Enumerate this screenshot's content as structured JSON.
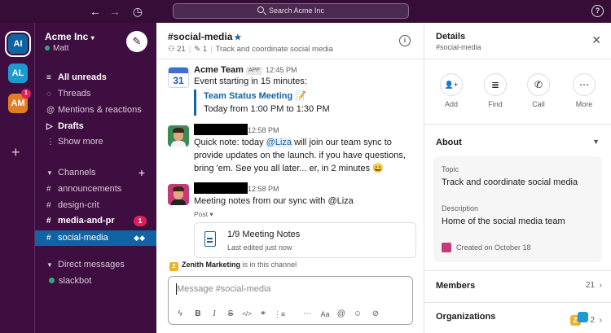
{
  "search": {
    "placeholder": "Search Acme Inc"
  },
  "topbar": {
    "help": "?"
  },
  "workspaces": [
    {
      "label": "AI",
      "color": "#1164a3",
      "active": true
    },
    {
      "label": "AL",
      "color": "#1d9bd1",
      "active": false
    },
    {
      "label": "AM",
      "color": "#e37d23",
      "active": false,
      "badge": "1"
    }
  ],
  "sidebar": {
    "workspace_name": "Acme Inc",
    "user": "Matt",
    "nav": [
      {
        "icon": "≡",
        "label": "All unreads",
        "bold": true
      },
      {
        "icon": "◌",
        "label": "Threads",
        "bold": false
      },
      {
        "icon": "@",
        "label": "Mentions & reactions",
        "bold": false
      },
      {
        "icon": "▷",
        "label": "Drafts",
        "bold": true
      },
      {
        "icon": "⋮",
        "label": "Show more",
        "bold": false
      }
    ],
    "channels_header": "Channels",
    "channels": [
      {
        "label": "announcements",
        "bold": false
      },
      {
        "label": "design-crit",
        "bold": false
      },
      {
        "label": "media-and-pr",
        "bold": true,
        "badge": "1"
      },
      {
        "label": "social-media",
        "bold": false,
        "selected": true
      }
    ],
    "dm_header": "Direct messages",
    "dms": [
      {
        "label": "slackbot"
      }
    ]
  },
  "channel": {
    "name": "#social-media",
    "members": "21",
    "pins": "1",
    "topic": "Track and coordinate social media"
  },
  "messages": [
    {
      "author": "Acme Team",
      "app_tag": "APP",
      "time": "12:45 PM",
      "avatar_text": "31",
      "text": "Event starting in 15 minutes:",
      "quote_title": "Team Status Meeting 📝",
      "quote_text": "Today from 1:00 PM to 1:30 PM"
    },
    {
      "time": "12:58 PM",
      "text_pre": "Quick note: today ",
      "mention": "@Liza",
      "text_post": " will join our team sync to provide updates on the launch. if you have questions, bring 'em. See you all later... er, in 2 minutes 😄"
    },
    {
      "time": "12:58 PM",
      "text": "Meeting notes from our sync with @Liza",
      "post_label": "Post ▾",
      "post_title": "1/9 Meeting Notes",
      "post_sub": "Last edited just now"
    }
  ],
  "in_channel": {
    "badge": "Z",
    "name": "Zenith Marketing",
    "suffix": "is in this channel"
  },
  "composer": {
    "placeholder": "Message #social-media"
  },
  "details": {
    "title": "Details",
    "subtitle": "#social-media",
    "actions": [
      {
        "icon": "👤+",
        "label": "Add"
      },
      {
        "icon": "≣",
        "label": "Find"
      },
      {
        "icon": "✆",
        "label": "Call"
      },
      {
        "icon": "⋯",
        "label": "More"
      }
    ],
    "about_label": "About",
    "topic_label": "Topic",
    "topic_value": "Track and coordinate social media",
    "description_label": "Description",
    "description_value": "Home of the social media team",
    "created": "Created on October 18",
    "members_label": "Members",
    "members_count": "21",
    "orgs_label": "Organizations",
    "orgs_count": "2",
    "org_badge": "Z"
  }
}
